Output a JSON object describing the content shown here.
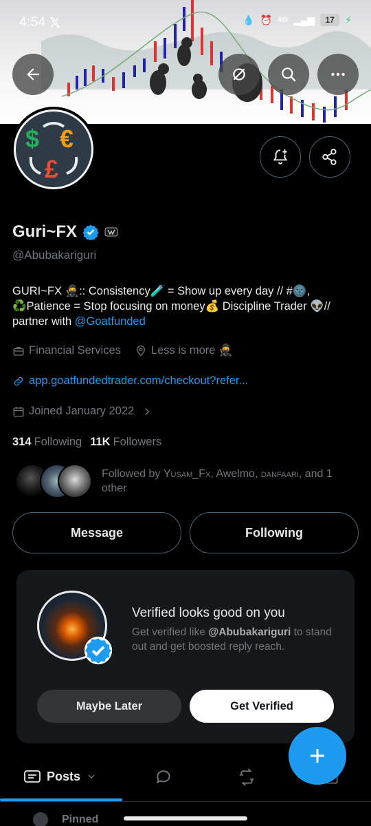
{
  "status_bar": {
    "time": "4:54",
    "network": "4G",
    "battery": "17"
  },
  "profile": {
    "name": "Guri~FX",
    "handle": "@Abubakariguri",
    "bio_text": "GURI~FX 🥷:: Consistency🧪 = Show up every day // #🌚, ♻️Patience = Stop focusing on money💰 Discipline Trader 👽// partner with ",
    "bio_link": "@Goatfunded",
    "category": "Financial Services",
    "location": "Less is more 🥷",
    "website": "app.goatfundedtrader.com/checkout?refer...",
    "joined": "Joined January 2022",
    "following_count": "314",
    "following_label": "Following",
    "followers_count": "11K",
    "followers_label": "Followers",
    "followed_by_prefix": "Followed by ",
    "followed_by_1": "Yusam_Fx",
    "followed_by_2": "Awelmo",
    "followed_by_3": "danfaari",
    "followed_by_suffix": ", and 1 other"
  },
  "buttons": {
    "message": "Message",
    "following": "Following"
  },
  "verified_card": {
    "title": "Verified looks good on you",
    "sub_prefix": "Get verified like ",
    "sub_handle": "@Abubakariguri",
    "sub_suffix": " to stand out and get boosted reply reach.",
    "maybe_later": "Maybe Later",
    "get_verified": "Get Verified"
  },
  "tabs": {
    "posts": "Posts"
  },
  "pinned": {
    "label": "Pinned"
  },
  "colors": {
    "accent": "#1d9bf0",
    "background": "#000000",
    "card": "#16181c",
    "muted": "#71767b"
  }
}
